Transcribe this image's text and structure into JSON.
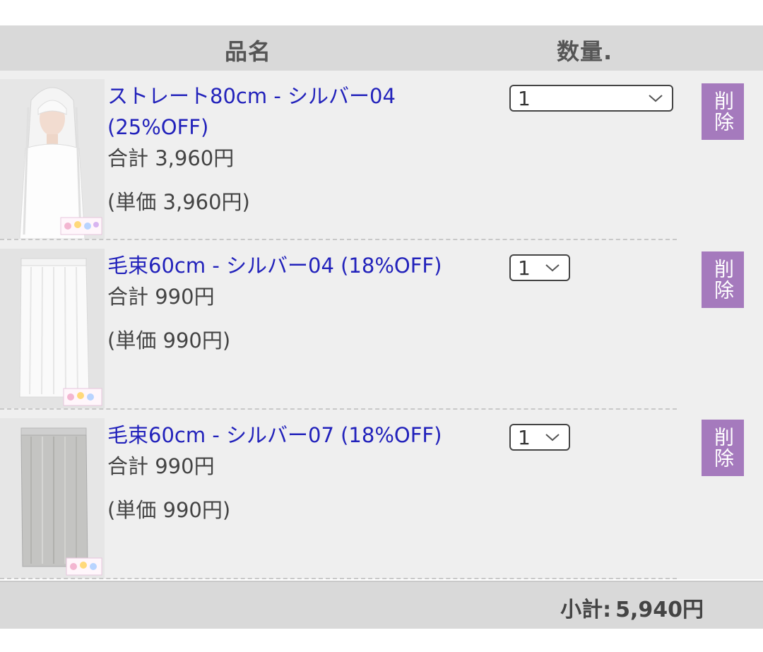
{
  "header": {
    "col_name": "品名",
    "col_qty": "数量."
  },
  "items": [
    {
      "title": "ストレート80cm - シルバー04 (25%OFF)",
      "total": "合計 3,960円",
      "unit_price": "(単価 3,960円)",
      "quantity": "1",
      "delete_label": "削除",
      "image": "white-long-straight-wig-on-mannequin"
    },
    {
      "title": "毛束60cm - シルバー04 (18%OFF)",
      "total": "合計 990円",
      "unit_price": "(単価 990円)",
      "quantity": "1",
      "delete_label": "削除",
      "image": "white-hair-extension-bundle"
    },
    {
      "title": "毛束60cm - シルバー07 (18%OFF)",
      "total": "合計 990円",
      "unit_price": "(単価 990円)",
      "quantity": "1",
      "delete_label": "削除",
      "image": "gray-hair-extension-bundle"
    }
  ],
  "footer": {
    "subtotal_label": "小計:",
    "subtotal_value": "5,940円"
  },
  "colors": {
    "header_bg": "#d9d9d9",
    "row_bg": "#efefef",
    "link": "#2222bb",
    "delete_button": "#a57abd"
  }
}
